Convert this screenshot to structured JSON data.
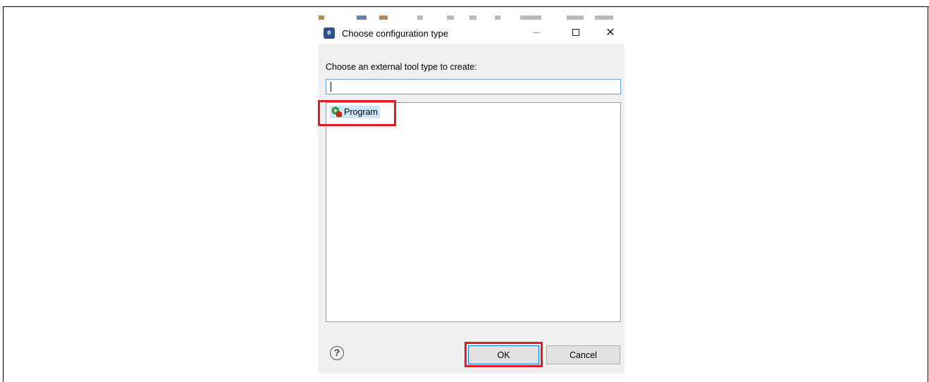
{
  "dialog": {
    "title": "Choose configuration type",
    "app_icon": "e",
    "window_controls": {
      "minimize": "minimize-icon",
      "maximize": "maximize-icon",
      "close_symbol": "✕"
    }
  },
  "content": {
    "prompt": "Choose an external tool type to create:",
    "filter_value": "",
    "items": [
      {
        "label": "Program",
        "icon": "program-launch-icon",
        "selected": true
      }
    ]
  },
  "footer": {
    "help_symbol": "?",
    "ok_label": "OK",
    "cancel_label": "Cancel"
  },
  "colors": {
    "highlight": "#e31b23",
    "selection": "#cce8ff",
    "focus_border": "#0078d7"
  }
}
